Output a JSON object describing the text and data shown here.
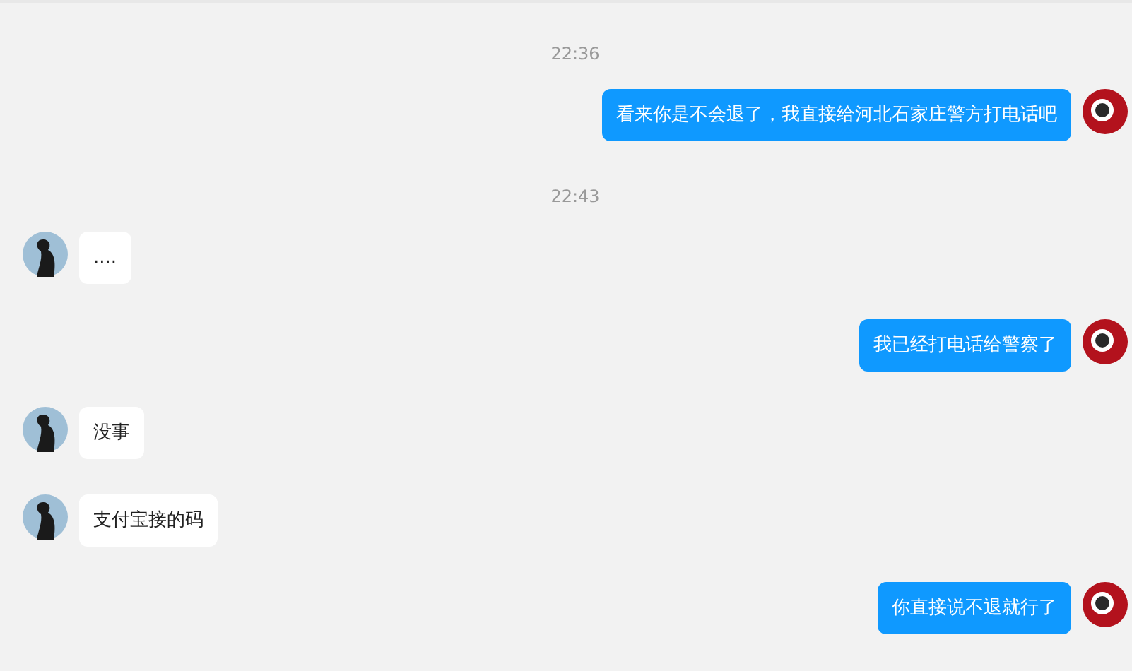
{
  "messages": [
    {
      "kind": "time",
      "text": "22:36"
    },
    {
      "kind": "out",
      "text": "看来你是不会退了，我直接给河北石家庄警方打电话吧"
    },
    {
      "kind": "time",
      "text": "22:43"
    },
    {
      "kind": "in",
      "text": "...."
    },
    {
      "kind": "out",
      "text": "我已经打电话给警察了"
    },
    {
      "kind": "in",
      "text": "没事"
    },
    {
      "kind": "in",
      "text": "支付宝接的码"
    },
    {
      "kind": "out",
      "text": "你直接说不退就行了"
    }
  ]
}
